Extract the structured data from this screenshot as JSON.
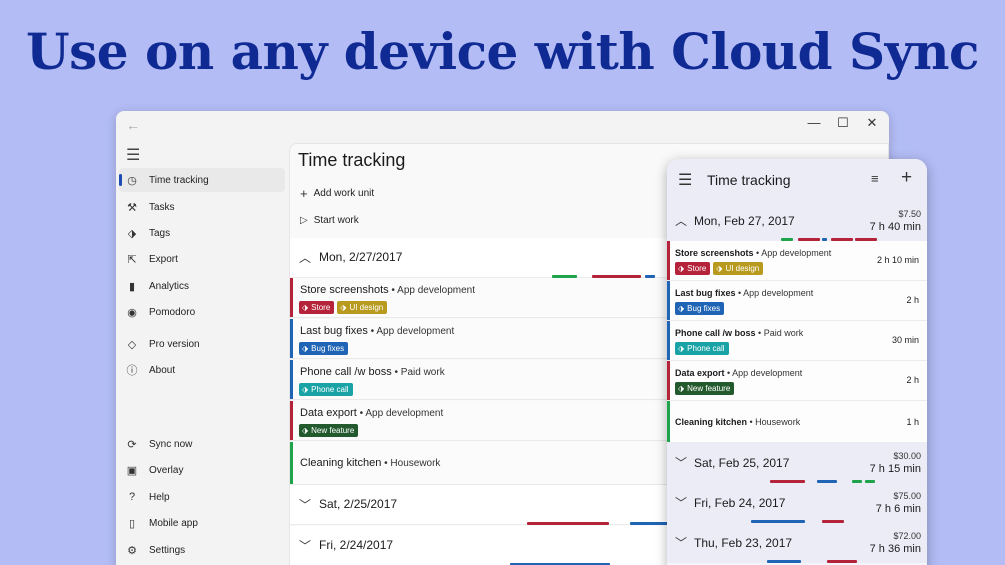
{
  "headline": "Use on any device with Cloud Sync",
  "colors": {
    "red": "#b4233a",
    "yellow": "#b89b1e",
    "blue": "#1f64b5",
    "teal": "#1aa3a6",
    "darkgreen": "#225a2e",
    "green": "#1fa34b",
    "headline": "#0f2a93"
  },
  "window": {
    "back_icon": "back-arrow-icon",
    "minimize": "—",
    "maximize": "☐",
    "close": "✕"
  },
  "sidebar": {
    "items": [
      {
        "label": "Time tracking",
        "icon": "timer-icon",
        "glyph": "◷"
      },
      {
        "label": "Tasks",
        "icon": "wrench-icon",
        "glyph": "⚒"
      },
      {
        "label": "Tags",
        "icon": "tag-icon",
        "glyph": "⬗"
      },
      {
        "label": "Export",
        "icon": "export-icon",
        "glyph": "⇱"
      },
      {
        "label": "Analytics",
        "icon": "chart-icon",
        "glyph": "▮"
      },
      {
        "label": "Pomodoro",
        "icon": "pomodoro-icon",
        "glyph": "◉"
      },
      {
        "label": "Pro version",
        "icon": "diamond-icon",
        "glyph": "◇"
      },
      {
        "label": "About",
        "icon": "info-icon",
        "glyph": "ⓘ"
      },
      {
        "label": "Sync now",
        "icon": "sync-icon",
        "glyph": "⟳"
      },
      {
        "label": "Overlay",
        "icon": "overlay-icon",
        "glyph": "▣"
      },
      {
        "label": "Help",
        "icon": "help-icon",
        "glyph": "?"
      },
      {
        "label": "Mobile app",
        "icon": "phone-icon",
        "glyph": "▯"
      },
      {
        "label": "Settings",
        "icon": "gear-icon",
        "glyph": "⚙"
      }
    ]
  },
  "content": {
    "title": "Time tracking",
    "add_work_unit": "Add work unit",
    "start_work": "Start work",
    "groups": [
      {
        "date": "Mon, 2/27/2017"
      },
      {
        "date": "Sat, 2/25/2017"
      },
      {
        "date": "Fri, 2/24/2017"
      }
    ],
    "entries": [
      {
        "title": "Store screenshots",
        "project": "App development",
        "tags": [
          {
            "label": "Store",
            "color": "red"
          },
          {
            "label": "UI design",
            "color": "yellow"
          }
        ],
        "stripe": "red"
      },
      {
        "title": "Last bug fixes",
        "project": "App development",
        "tags": [
          {
            "label": "Bug fixes",
            "color": "blue"
          }
        ],
        "stripe": "blue"
      },
      {
        "title": "Phone call /w boss",
        "project": "Paid work",
        "tags": [
          {
            "label": "Phone call",
            "color": "teal"
          }
        ],
        "stripe": "teal"
      },
      {
        "title": "Data export",
        "project": "App development",
        "tags": [
          {
            "label": "New feature",
            "color": "darkgreen"
          }
        ],
        "stripe": "red"
      },
      {
        "title": "Cleaning kitchen",
        "project": "Housework",
        "tags": [],
        "stripe": "green"
      }
    ],
    "separator": " • "
  },
  "mobile": {
    "title": "Time tracking",
    "groups": [
      {
        "date": "Mon, Feb 27, 2017",
        "amount": "$7.50",
        "duration": "7 h 40 min",
        "expanded": true
      },
      {
        "date": "Sat, Feb 25, 2017",
        "amount": "$30.00",
        "duration": "7 h 15 min",
        "expanded": false
      },
      {
        "date": "Fri, Feb 24, 2017",
        "amount": "$75.00",
        "duration": "7 h 6 min",
        "expanded": false
      },
      {
        "date": "Thu, Feb 23, 2017",
        "amount": "$72.00",
        "duration": "7 h 36 min",
        "expanded": false
      }
    ],
    "entries": [
      {
        "title": "Store screenshots",
        "project": "App development",
        "duration": "2 h 10 min"
      },
      {
        "title": "Last bug fixes",
        "project": "App development",
        "duration": "2 h"
      },
      {
        "title": "Phone call /w boss",
        "project": "Paid work",
        "duration": "30 min"
      },
      {
        "title": "Data export",
        "project": "App development",
        "duration": "2 h"
      },
      {
        "title": "Cleaning kitchen",
        "project": "Housework",
        "duration": "1 h"
      }
    ]
  }
}
